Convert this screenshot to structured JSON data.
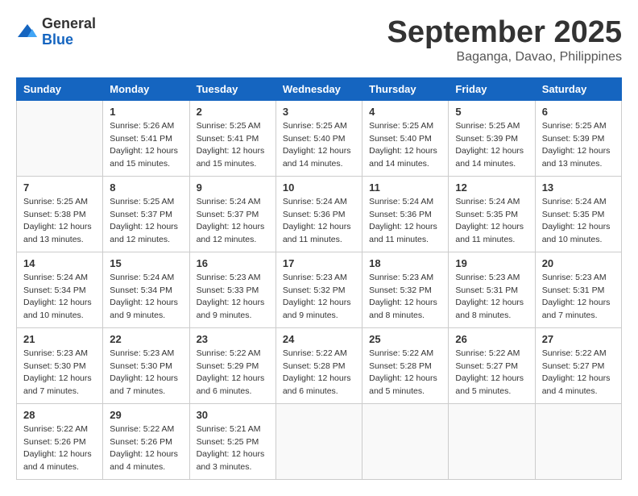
{
  "logo": {
    "general": "General",
    "blue": "Blue"
  },
  "title": "September 2025",
  "subtitle": "Baganga, Davao, Philippines",
  "headers": [
    "Sunday",
    "Monday",
    "Tuesday",
    "Wednesday",
    "Thursday",
    "Friday",
    "Saturday"
  ],
  "weeks": [
    [
      {
        "day": "",
        "info": ""
      },
      {
        "day": "1",
        "info": "Sunrise: 5:26 AM\nSunset: 5:41 PM\nDaylight: 12 hours\nand 15 minutes."
      },
      {
        "day": "2",
        "info": "Sunrise: 5:25 AM\nSunset: 5:41 PM\nDaylight: 12 hours\nand 15 minutes."
      },
      {
        "day": "3",
        "info": "Sunrise: 5:25 AM\nSunset: 5:40 PM\nDaylight: 12 hours\nand 14 minutes."
      },
      {
        "day": "4",
        "info": "Sunrise: 5:25 AM\nSunset: 5:40 PM\nDaylight: 12 hours\nand 14 minutes."
      },
      {
        "day": "5",
        "info": "Sunrise: 5:25 AM\nSunset: 5:39 PM\nDaylight: 12 hours\nand 14 minutes."
      },
      {
        "day": "6",
        "info": "Sunrise: 5:25 AM\nSunset: 5:39 PM\nDaylight: 12 hours\nand 13 minutes."
      }
    ],
    [
      {
        "day": "7",
        "info": "Sunrise: 5:25 AM\nSunset: 5:38 PM\nDaylight: 12 hours\nand 13 minutes."
      },
      {
        "day": "8",
        "info": "Sunrise: 5:25 AM\nSunset: 5:37 PM\nDaylight: 12 hours\nand 12 minutes."
      },
      {
        "day": "9",
        "info": "Sunrise: 5:24 AM\nSunset: 5:37 PM\nDaylight: 12 hours\nand 12 minutes."
      },
      {
        "day": "10",
        "info": "Sunrise: 5:24 AM\nSunset: 5:36 PM\nDaylight: 12 hours\nand 11 minutes."
      },
      {
        "day": "11",
        "info": "Sunrise: 5:24 AM\nSunset: 5:36 PM\nDaylight: 12 hours\nand 11 minutes."
      },
      {
        "day": "12",
        "info": "Sunrise: 5:24 AM\nSunset: 5:35 PM\nDaylight: 12 hours\nand 11 minutes."
      },
      {
        "day": "13",
        "info": "Sunrise: 5:24 AM\nSunset: 5:35 PM\nDaylight: 12 hours\nand 10 minutes."
      }
    ],
    [
      {
        "day": "14",
        "info": "Sunrise: 5:24 AM\nSunset: 5:34 PM\nDaylight: 12 hours\nand 10 minutes."
      },
      {
        "day": "15",
        "info": "Sunrise: 5:24 AM\nSunset: 5:34 PM\nDaylight: 12 hours\nand 9 minutes."
      },
      {
        "day": "16",
        "info": "Sunrise: 5:23 AM\nSunset: 5:33 PM\nDaylight: 12 hours\nand 9 minutes."
      },
      {
        "day": "17",
        "info": "Sunrise: 5:23 AM\nSunset: 5:32 PM\nDaylight: 12 hours\nand 9 minutes."
      },
      {
        "day": "18",
        "info": "Sunrise: 5:23 AM\nSunset: 5:32 PM\nDaylight: 12 hours\nand 8 minutes."
      },
      {
        "day": "19",
        "info": "Sunrise: 5:23 AM\nSunset: 5:31 PM\nDaylight: 12 hours\nand 8 minutes."
      },
      {
        "day": "20",
        "info": "Sunrise: 5:23 AM\nSunset: 5:31 PM\nDaylight: 12 hours\nand 7 minutes."
      }
    ],
    [
      {
        "day": "21",
        "info": "Sunrise: 5:23 AM\nSunset: 5:30 PM\nDaylight: 12 hours\nand 7 minutes."
      },
      {
        "day": "22",
        "info": "Sunrise: 5:23 AM\nSunset: 5:30 PM\nDaylight: 12 hours\nand 7 minutes."
      },
      {
        "day": "23",
        "info": "Sunrise: 5:22 AM\nSunset: 5:29 PM\nDaylight: 12 hours\nand 6 minutes."
      },
      {
        "day": "24",
        "info": "Sunrise: 5:22 AM\nSunset: 5:28 PM\nDaylight: 12 hours\nand 6 minutes."
      },
      {
        "day": "25",
        "info": "Sunrise: 5:22 AM\nSunset: 5:28 PM\nDaylight: 12 hours\nand 5 minutes."
      },
      {
        "day": "26",
        "info": "Sunrise: 5:22 AM\nSunset: 5:27 PM\nDaylight: 12 hours\nand 5 minutes."
      },
      {
        "day": "27",
        "info": "Sunrise: 5:22 AM\nSunset: 5:27 PM\nDaylight: 12 hours\nand 4 minutes."
      }
    ],
    [
      {
        "day": "28",
        "info": "Sunrise: 5:22 AM\nSunset: 5:26 PM\nDaylight: 12 hours\nand 4 minutes."
      },
      {
        "day": "29",
        "info": "Sunrise: 5:22 AM\nSunset: 5:26 PM\nDaylight: 12 hours\nand 4 minutes."
      },
      {
        "day": "30",
        "info": "Sunrise: 5:21 AM\nSunset: 5:25 PM\nDaylight: 12 hours\nand 3 minutes."
      },
      {
        "day": "",
        "info": ""
      },
      {
        "day": "",
        "info": ""
      },
      {
        "day": "",
        "info": ""
      },
      {
        "day": "",
        "info": ""
      }
    ]
  ]
}
